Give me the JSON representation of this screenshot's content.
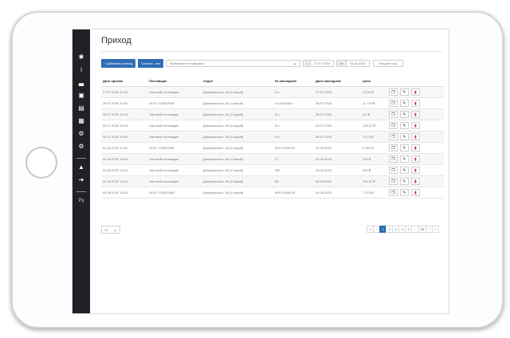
{
  "page_title": "Приход",
  "sidebar": {
    "icons": [
      "home-icon",
      "info-icon",
      "chart-icon",
      "list-icon",
      "box-icon",
      "document-icon",
      "settings-icon",
      "settings-2-icon",
      "user-icon",
      "logout-icon"
    ],
    "glyphs": [
      "✱",
      "i",
      "▃",
      "▣",
      "▤",
      "▦",
      "⚙",
      "⚙",
      "▲",
      "➜"
    ],
    "language": "Ру"
  },
  "toolbar": {
    "add_label": "+ Добавить приход",
    "download_label": "Скачать .xlsx",
    "supplier_placeholder": "Выберите поставщика",
    "date_from_label": "с",
    "date_from": "27.07.2020",
    "date_to_label": "по",
    "date_to": "03.08.2022",
    "code_placeholder": "Введите код"
  },
  "table": {
    "headers": [
      "Дата приема",
      "Поставщик",
      "Отдел",
      "№ накладной",
      "Дата накладной",
      "Цена"
    ],
    "rows": [
      [
        "27.07.2020 10:43",
        "Частный поставщик",
        "Дзержинского, 64 (Старый)",
        "б.н",
        "27.07.2020",
        "47,59 ₽"
      ],
      [
        "28.07.2020 12:00",
        "ООО \"НОВОПАК\"",
        "Дзержинского, 64 (Старый)",
        "н-н-0015641",
        "28.07.2020",
        "11 750 ₽"
      ],
      [
        "28.07.2020 15:19",
        "Частный поставщик",
        "Дзержинского, 64 (Старый)",
        "б.н",
        "28.07.2020",
        "0,2 ₽"
      ],
      [
        "29.07.2020 15:15",
        "Частный поставщик",
        "Дзержинского, 64 (Старый)",
        "б.н",
        "29.07.2020",
        "149,22 ₽"
      ],
      [
        "30.07.2020 15:49",
        "Частный поставщик",
        "Дзержинского, 64 (Старый)",
        "б.н",
        "30.07.2020",
        "79,75 ₽"
      ],
      [
        "01.08.2020 11:30",
        "ООО \"НОВОПАК\"",
        "Дзержинского, 64 (Старый)",
        "КНП-0016203",
        "01.08.2020",
        "5 460 ₽"
      ],
      [
        "01.08.2020 15:03",
        "Частный поставщик",
        "Дзержинского, 64 (Старый)",
        "27",
        "01.08.2020",
        "132 ₽"
      ],
      [
        "03.08.2020 15:19",
        "Частный поставщик",
        "Дзержинского, 64 (Старый)",
        "330",
        "03.08.2020",
        "249 ₽"
      ],
      [
        "04.08.2020 13:04",
        "Частный поставщик",
        "Дзержинского, 64 (Старый)",
        "83",
        "04.08.2020",
        "204,30 ₽"
      ],
      [
        "04.08.2020 13:18",
        "ООО \"НОВОПАК\"",
        "Дзержинского, 64 (Старый)",
        "КНП-0016425",
        "04.08.2020",
        "7 070 ₽"
      ]
    ],
    "action_glyphs": {
      "copy": "❐",
      "edit": "✎",
      "delete": "▮"
    }
  },
  "footer": {
    "per_page": "10",
    "pages": [
      "«",
      "‹",
      "1",
      "2",
      "3",
      "4",
      "5",
      "...",
      "28",
      "›",
      "»"
    ],
    "active_page": "1"
  },
  "colors": {
    "accent": "#2d6db5",
    "sidebar": "#1e2227",
    "delete": "#c9302c"
  }
}
